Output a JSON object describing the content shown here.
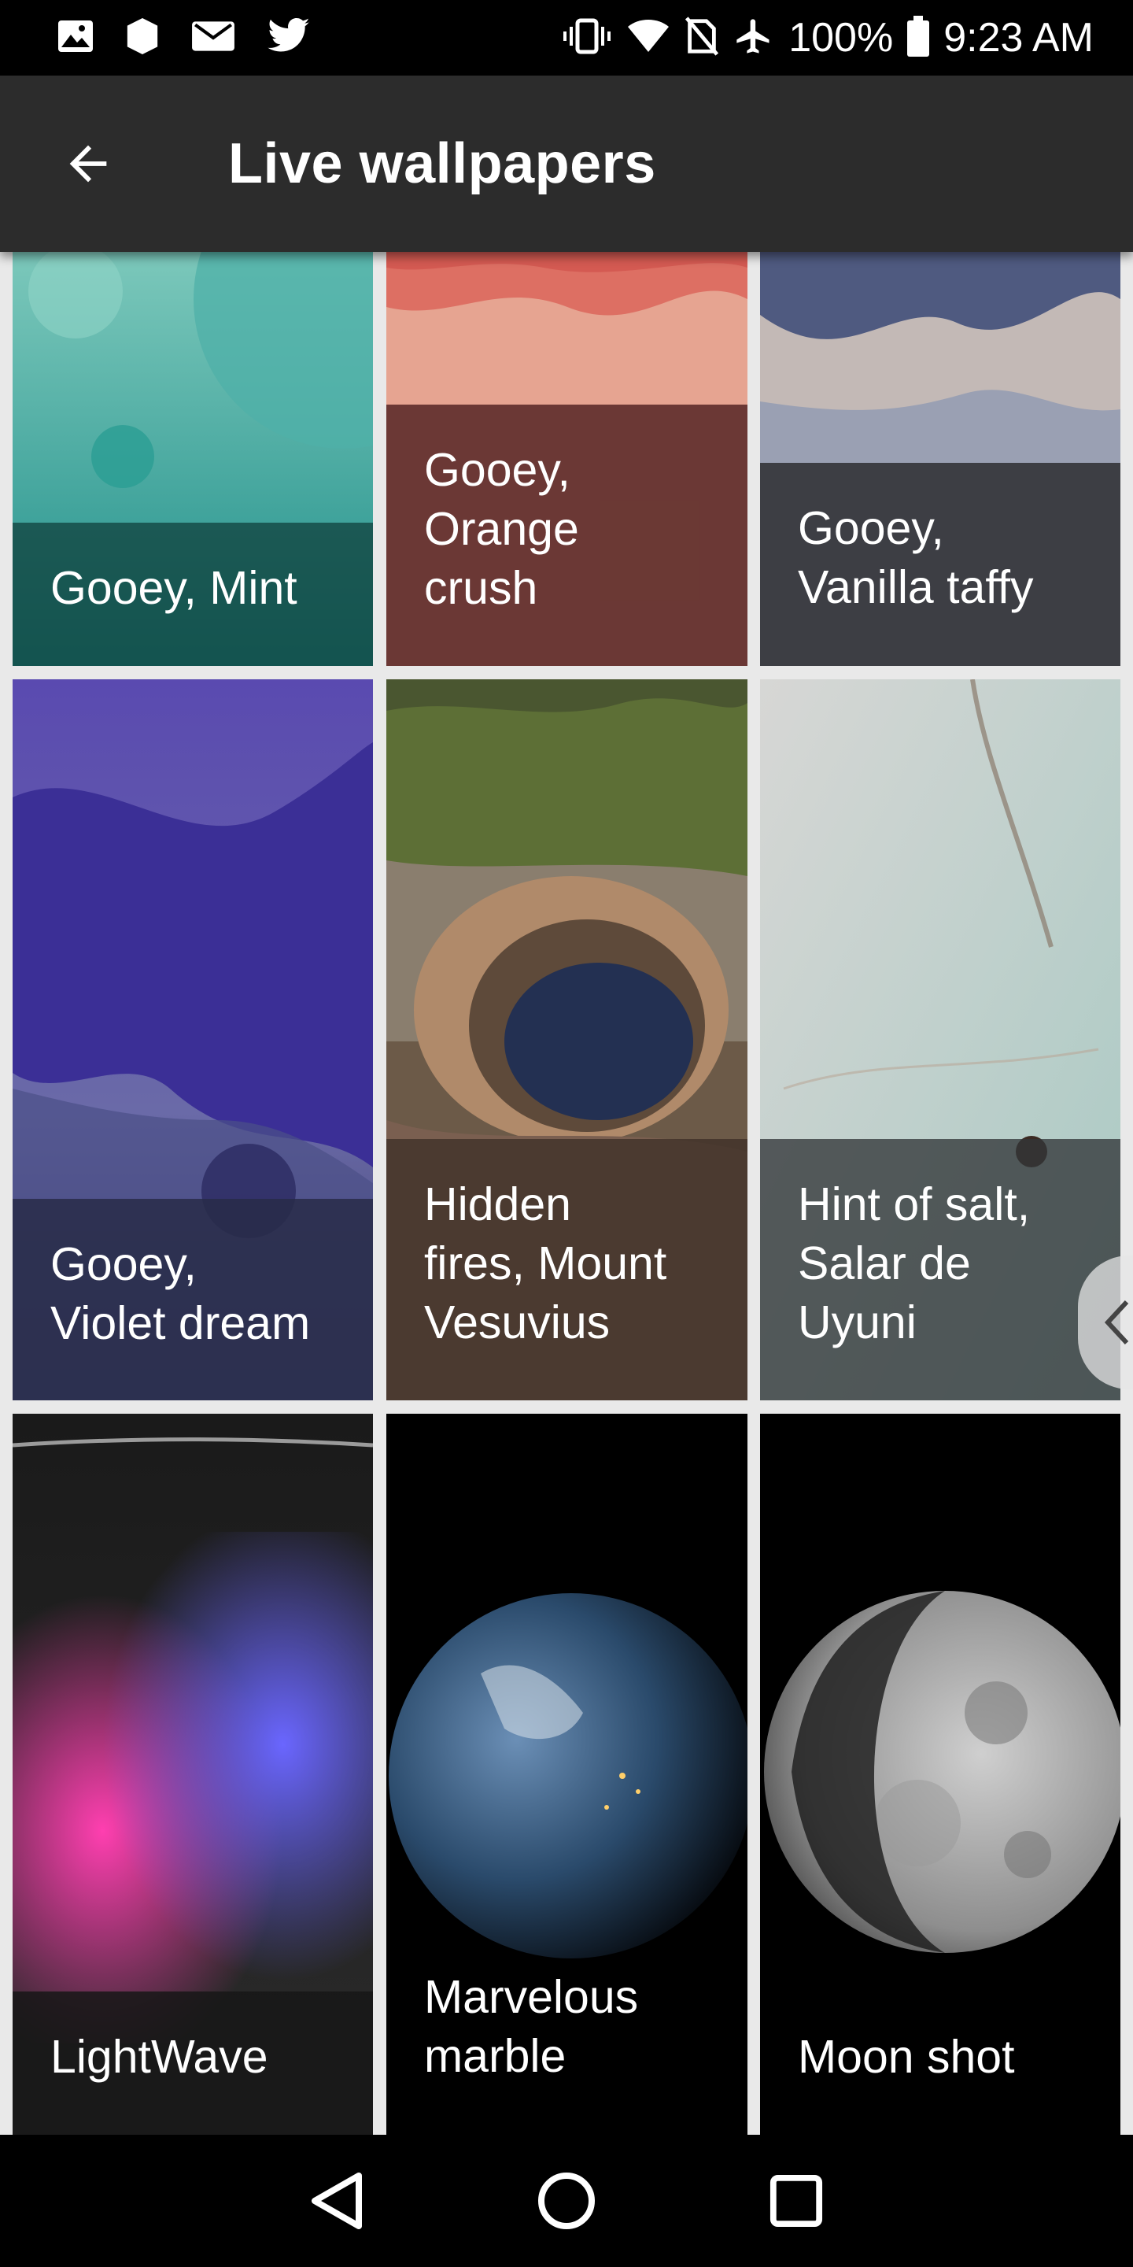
{
  "status_bar": {
    "left_icons": [
      "image-icon",
      "shield-icon",
      "mail-icon",
      "twitter-icon"
    ],
    "right_icons": [
      "vibrate-icon",
      "wifi-icon",
      "no-sim-icon",
      "airplane-icon"
    ],
    "battery_percent": "100%",
    "time": "9:23 AM"
  },
  "app_bar": {
    "title": "Live wallpapers",
    "back_icon": "arrow-back-icon"
  },
  "wallpapers": [
    {
      "label": "Gooey, Mint",
      "art": "gooey-mint"
    },
    {
      "label": "Gooey,\nOrange\ncrush",
      "art": "gooey-orange"
    },
    {
      "label": "Gooey,\nVanilla taffy",
      "art": "gooey-vanilla"
    },
    {
      "label": "Gooey,\nViolet dream",
      "art": "gooey-violet"
    },
    {
      "label": "Hidden\nfires, Mount\nVesuvius",
      "art": "vesuvius"
    },
    {
      "label": "Hint of salt,\nSalar de\nUyuni",
      "art": "salar"
    },
    {
      "label": "LightWave",
      "art": "lightwave"
    },
    {
      "label": "Marvelous\nmarble",
      "art": "earth"
    },
    {
      "label": "Moon shot",
      "art": "moon"
    }
  ],
  "colors": {
    "status_bar_bg": "#000000",
    "app_bar_bg": "#2c2c2c",
    "grid_bg": "#e9e9e9",
    "nav_bar_bg": "#000000"
  },
  "nav_bar": {
    "back_icon": "nav-back-icon",
    "home_icon": "nav-home-icon",
    "recents_icon": "nav-recents-icon"
  }
}
